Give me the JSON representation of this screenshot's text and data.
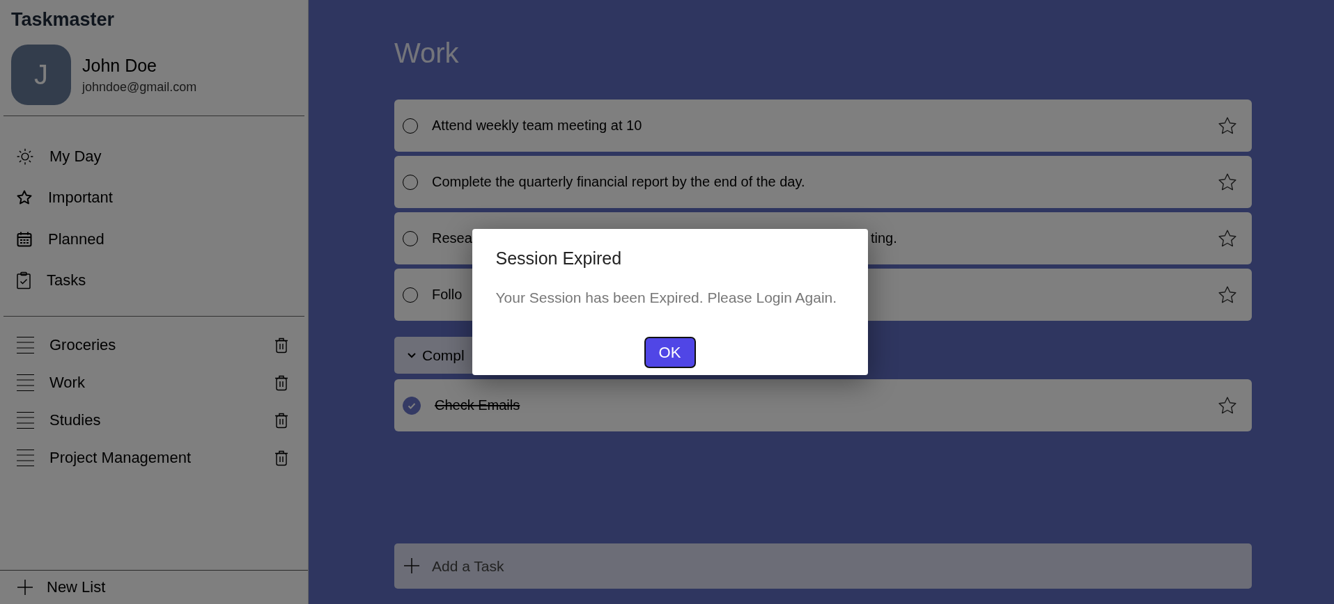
{
  "sidebar": {
    "app_title": "Taskmaster",
    "user": {
      "initial": "J",
      "name": "John Doe",
      "email": "johndoe@gmail.com"
    },
    "nav": [
      {
        "label": "My Day",
        "selected": false
      },
      {
        "label": "Important",
        "selected": false
      },
      {
        "label": "Planned",
        "selected": false
      },
      {
        "label": "Tasks",
        "selected": false
      }
    ],
    "lists": [
      {
        "label": "Groceries",
        "selected": false
      },
      {
        "label": "Work",
        "selected": false
      },
      {
        "label": "Studies",
        "selected": false
      },
      {
        "label": "Project Management",
        "selected": false
      }
    ],
    "new_list": "New List"
  },
  "main": {
    "title": "Work",
    "tasks": [
      {
        "text": "Attend weekly team meeting at 10",
        "completed": false,
        "important": false
      },
      {
        "text": "Complete the quarterly financial report by the end of the day.",
        "completed": false,
        "important": false
      },
      {
        "text": "Resea",
        "text_end": "ting.",
        "completed": false,
        "important": false
      },
      {
        "text": "Follo",
        "completed": false,
        "important": false
      }
    ],
    "completed_section": {
      "label": "Compl",
      "expanded": true
    },
    "completed_tasks": [
      {
        "text": "Check Emails",
        "completed": true,
        "important": false
      }
    ],
    "add_task": {
      "placeholder": "Add a Task"
    }
  },
  "dialog": {
    "title": "Session Expired",
    "message": "Your Session has been Expired. Please Login Again.",
    "button": "OK"
  }
}
